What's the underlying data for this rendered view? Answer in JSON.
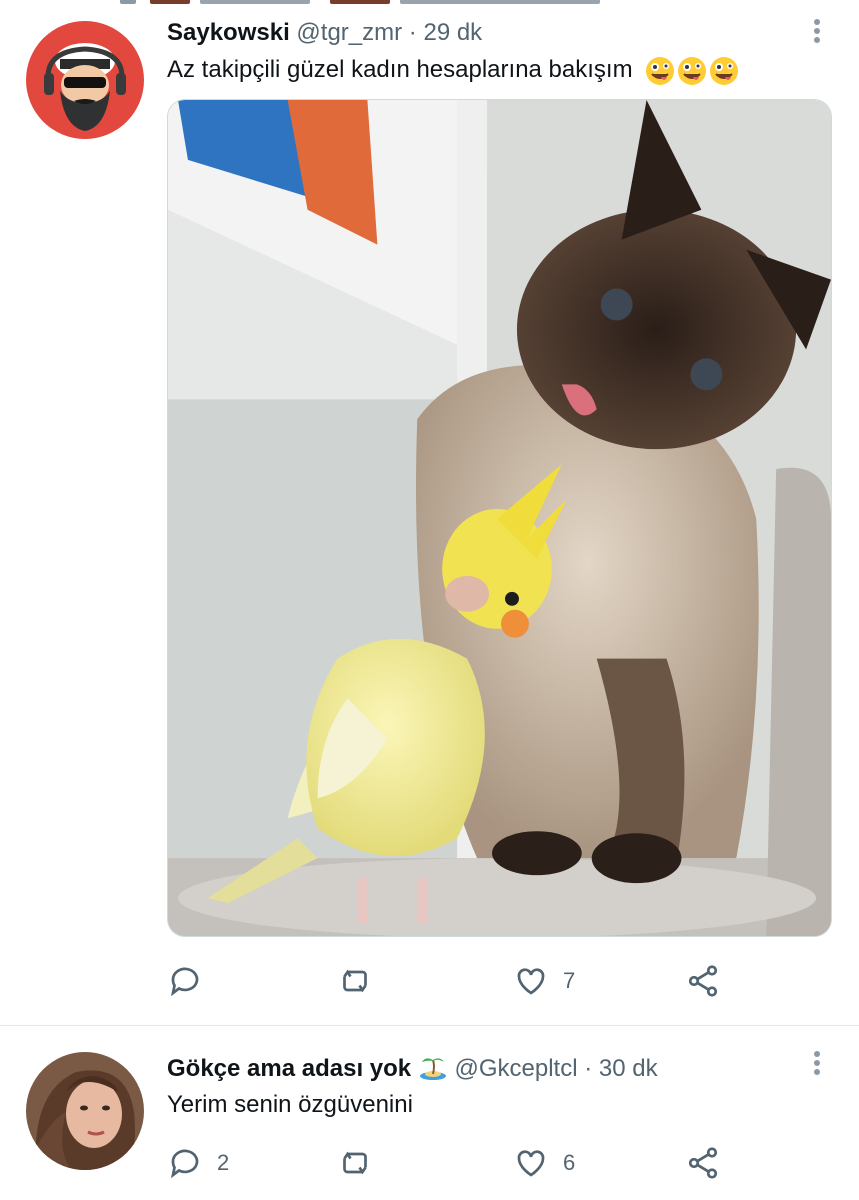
{
  "tweets": [
    {
      "display_name": "Saykowski",
      "handle": "@tgr_zmr",
      "separator": "·",
      "time": "29 dk",
      "text": "Az takipçili güzel kadın hesaplarına bakışım",
      "text_emojis": [
        "zany-face-emoji",
        "zany-face-emoji",
        "zany-face-emoji"
      ],
      "media_alt_icon": "photo-cat-and-cockatiel",
      "actions": {
        "reply_count": "",
        "retweet_count": "",
        "like_count": "7",
        "share_count": ""
      }
    },
    {
      "display_name": "Gökçe ama adası yok",
      "name_emoji": "desert-island-emoji",
      "handle": "@Gkcepltcl",
      "separator": "·",
      "time": "30 dk",
      "text": "Yerim senin özgüvenini",
      "actions": {
        "reply_count": "2",
        "retweet_count": "",
        "like_count": "6",
        "share_count": ""
      }
    }
  ],
  "colors": {
    "text_primary": "#0f1419",
    "text_secondary": "#536471",
    "divider": "#e1e6ea",
    "avatar1_bg": "#e2483d"
  }
}
